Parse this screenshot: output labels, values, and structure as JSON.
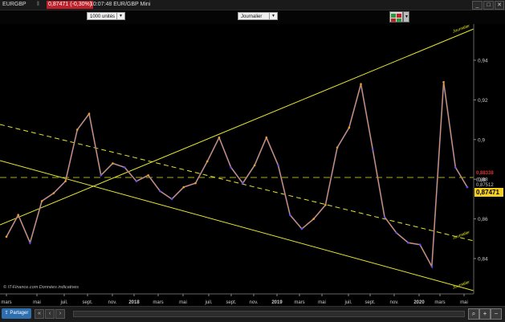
{
  "titlebar": {
    "symbol": "EURGBP",
    "price_change": "0,87471 (-0,30%)",
    "time_title": "10:07:48 EUR/GBP Mini",
    "buttons": [
      "_",
      "□",
      "✕"
    ]
  },
  "toolbar": {
    "units": "1000 unités",
    "period": "Journalier"
  },
  "chart": {
    "y_ticks": [
      "0,94",
      "0,92",
      "0,9",
      "0,88",
      "0,86",
      "0,84"
    ],
    "x_ticks": [
      "mars",
      "mai",
      "juil.",
      "sept.",
      "nov.",
      "2018",
      "mars",
      "mai",
      "juil.",
      "sept.",
      "nov.",
      "2019",
      "mars",
      "mai",
      "juil.",
      "sept.",
      "nov.",
      "2020",
      "mars",
      "mai"
    ],
    "price_labels": {
      "high_level": "0,88338",
      "level": "0,88",
      "ref": "0,87512",
      "last": "0,87471"
    },
    "trend_labels": [
      "Journalier",
      "Journalier",
      "Journalier"
    ],
    "credit": "© IT-Finance.com  Données indicatives",
    "colors": {
      "bg": "#000000",
      "trend": "#e6e62e",
      "bull": "#e8a020",
      "bear": "#5a50f0",
      "last": "#f5d020"
    }
  },
  "chart_data": {
    "type": "line",
    "series": [
      {
        "x": [
          "2017-02",
          "2017-03",
          "2017-04",
          "2017-05",
          "2017-06",
          "2017-07",
          "2017-08",
          "2017-09",
          "2017-10",
          "2017-11",
          "2017-12",
          "2018-01",
          "2018-02",
          "2018-03",
          "2018-04",
          "2018-05",
          "2018-06",
          "2018-07",
          "2018-08",
          "2018-09",
          "2018-10",
          "2018-11",
          "2018-12",
          "2019-01",
          "2019-02",
          "2019-03",
          "2019-04",
          "2019-05",
          "2019-06",
          "2019-07",
          "2019-08",
          "2019-09",
          "2019-10",
          "2019-11",
          "2019-12",
          "2020-01",
          "2020-02",
          "2020-03",
          "2020-04",
          "2020-05"
        ],
        "values": [
          0.851,
          0.862,
          0.848,
          0.869,
          0.873,
          0.879,
          0.905,
          0.913,
          0.882,
          0.888,
          0.886,
          0.879,
          0.882,
          0.874,
          0.87,
          0.876,
          0.878,
          0.889,
          0.901,
          0.886,
          0.878,
          0.887,
          0.901,
          0.887,
          0.862,
          0.855,
          0.86,
          0.867,
          0.896,
          0.906,
          0.928,
          0.895,
          0.861,
          0.853,
          0.848,
          0.847,
          0.836,
          0.929,
          0.886,
          0.876
        ]
      }
    ],
    "ylim": [
      0.83,
      0.955
    ]
  }
}
